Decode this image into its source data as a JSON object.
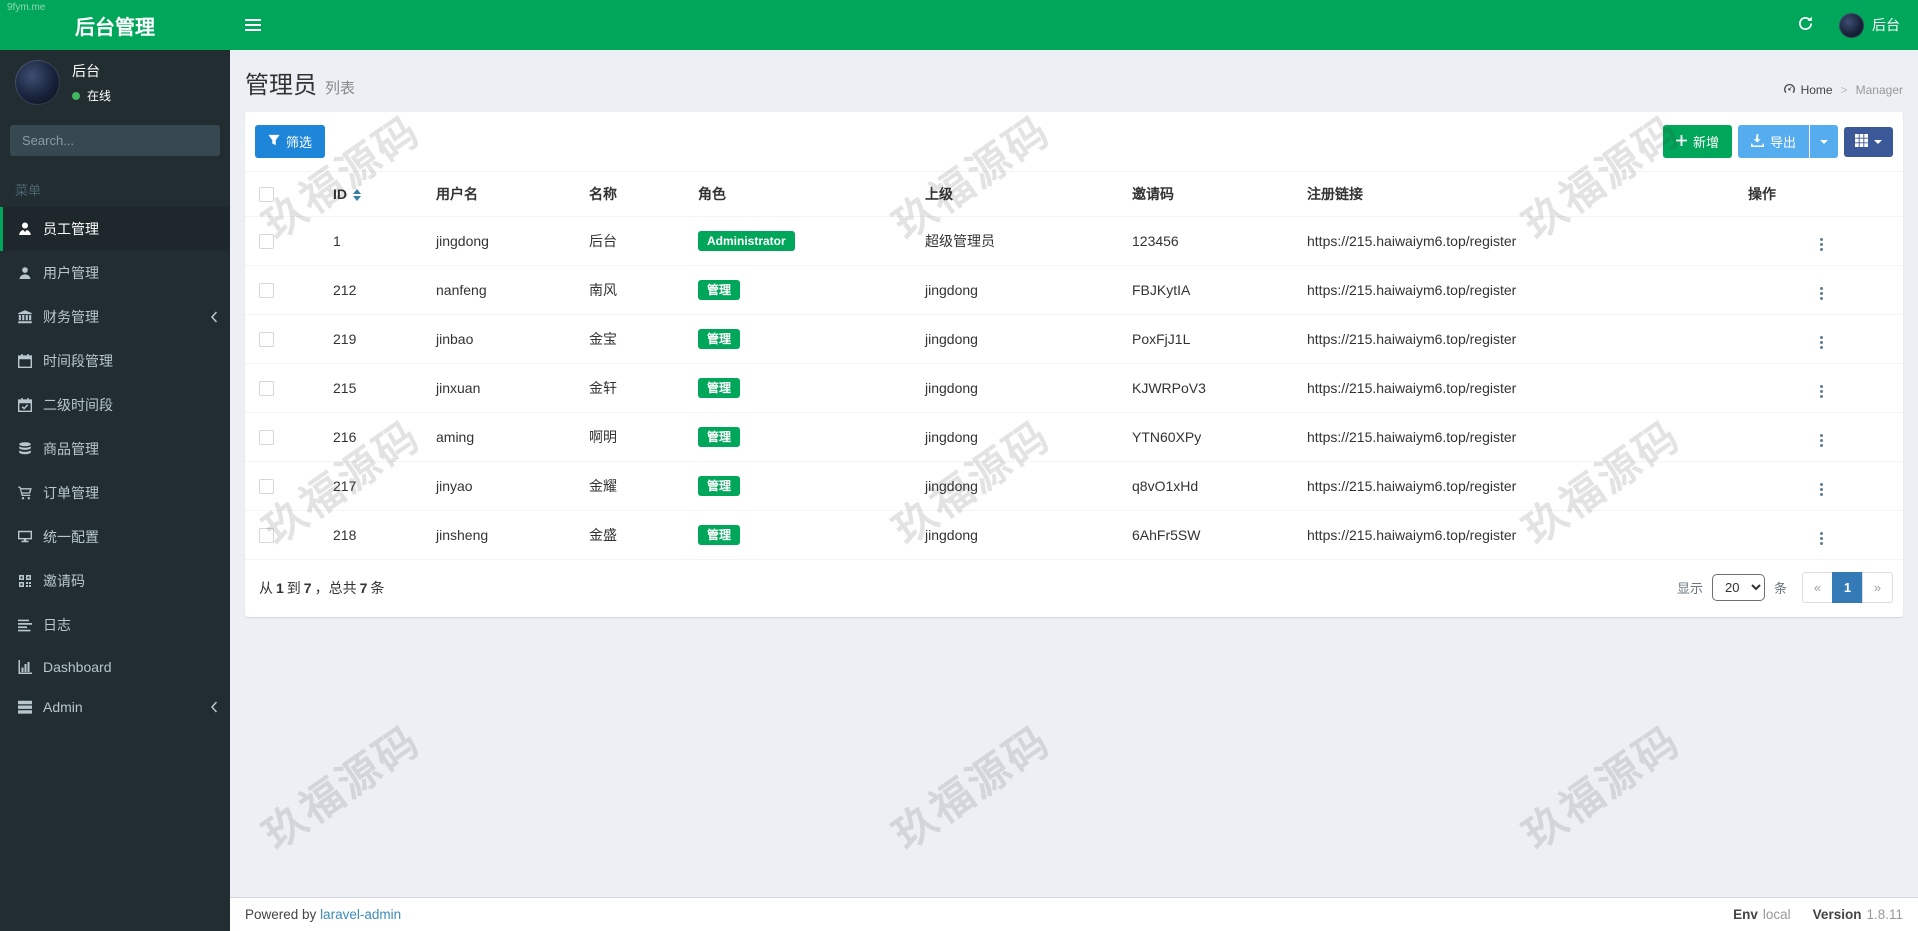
{
  "watermark": {
    "text": "玖福源码",
    "corner": "9fym.me"
  },
  "navbar": {
    "brand": "后台管理",
    "user_label": "后台"
  },
  "sidebar": {
    "user": {
      "name": "后台",
      "status": "在线"
    },
    "search_placeholder": "Search...",
    "section_label": "菜单",
    "items": [
      {
        "label": "员工管理",
        "icon": "user-tie-icon",
        "active": true
      },
      {
        "label": "用户管理",
        "icon": "user-icon"
      },
      {
        "label": "财务管理",
        "icon": "bank-icon",
        "chevron": true
      },
      {
        "label": "时间段管理",
        "icon": "calendar-icon"
      },
      {
        "label": "二级时间段",
        "icon": "calendar-check-icon"
      },
      {
        "label": "商品管理",
        "icon": "database-icon"
      },
      {
        "label": "订单管理",
        "icon": "cart-icon"
      },
      {
        "label": "统一配置",
        "icon": "desktop-icon"
      },
      {
        "label": "邀请码",
        "icon": "qrcode-icon"
      },
      {
        "label": "日志",
        "icon": "list-icon"
      },
      {
        "label": "Dashboard",
        "icon": "bar-chart-icon"
      },
      {
        "label": "Admin",
        "icon": "server-icon",
        "chevron": true
      }
    ]
  },
  "header": {
    "title": "管理员",
    "subtitle": "列表",
    "breadcrumb": [
      {
        "label": "Home"
      },
      {
        "label": "Manager"
      }
    ]
  },
  "toolbar": {
    "filter_label": "筛选",
    "add_label": "新增",
    "export_label": "导出"
  },
  "table": {
    "columns": [
      "ID",
      "用户名",
      "名称",
      "角色",
      "上级",
      "邀请码",
      "注册链接",
      "操作"
    ],
    "rows": [
      {
        "id": "1",
        "username": "jingdong",
        "name": "后台",
        "role": "Administrator",
        "parent": "超级管理员",
        "invite_code": "123456",
        "register_link": "https://215.haiwaiym6.top/register"
      },
      {
        "id": "212",
        "username": "nanfeng",
        "name": "南风",
        "role": "管理",
        "parent": "jingdong",
        "invite_code": "FBJKytIA",
        "register_link": "https://215.haiwaiym6.top/register"
      },
      {
        "id": "219",
        "username": "jinbao",
        "name": "金宝",
        "role": "管理",
        "parent": "jingdong",
        "invite_code": "PoxFjJ1L",
        "register_link": "https://215.haiwaiym6.top/register"
      },
      {
        "id": "215",
        "username": "jinxuan",
        "name": "金轩",
        "role": "管理",
        "parent": "jingdong",
        "invite_code": "KJWRPoV3",
        "register_link": "https://215.haiwaiym6.top/register"
      },
      {
        "id": "216",
        "username": "aming",
        "name": "啊明",
        "role": "管理",
        "parent": "jingdong",
        "invite_code": "YTN60XPy",
        "register_link": "https://215.haiwaiym6.top/register"
      },
      {
        "id": "217",
        "username": "jinyao",
        "name": "金耀",
        "role": "管理",
        "parent": "jingdong",
        "invite_code": "q8vO1xHd",
        "register_link": "https://215.haiwaiym6.top/register"
      },
      {
        "id": "218",
        "username": "jinsheng",
        "name": "金盛",
        "role": "管理",
        "parent": "jingdong",
        "invite_code": "6AhFr5SW",
        "register_link": "https://215.haiwaiym6.top/register"
      }
    ]
  },
  "table_footer": {
    "summary": {
      "t1": "从",
      "n1": "1",
      "t2": "到",
      "n2": "7",
      "t3": "，总共",
      "n3": "7",
      "t4": "条"
    },
    "per_page_prefix": "显示",
    "per_page": "20",
    "per_page_suffix": "条",
    "pages": [
      "«",
      "1",
      "»"
    ]
  },
  "footer": {
    "powered_by": "Powered by",
    "link": "laravel-admin",
    "env_label": "Env",
    "env_value": "local",
    "version_label": "Version",
    "version_value": "1.8.11"
  }
}
